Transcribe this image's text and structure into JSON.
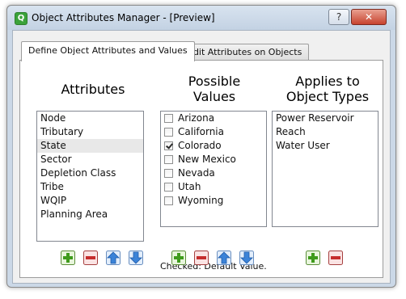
{
  "window": {
    "title": "Object Attributes Manager - [Preview]",
    "help_label": "?",
    "close_label": "✕"
  },
  "tabs": [
    {
      "label": "Define Object Attributes and Values",
      "active": true
    },
    {
      "label": "Edit Attributes on Objects",
      "active": false
    }
  ],
  "attributes": {
    "heading": "Attributes",
    "items": [
      "Node",
      "Tributary",
      "State",
      "Sector",
      "Depletion Class",
      "Tribe",
      "WQIP",
      "Planning Area"
    ],
    "selected": "State"
  },
  "values": {
    "heading_line1": "Possible",
    "heading_line2": "Values",
    "items": [
      {
        "label": "Arizona",
        "checked": false
      },
      {
        "label": "California",
        "checked": false
      },
      {
        "label": "Colorado",
        "checked": true
      },
      {
        "label": "New Mexico",
        "checked": false
      },
      {
        "label": "Nevada",
        "checked": false
      },
      {
        "label": "Utah",
        "checked": false
      },
      {
        "label": "Wyoming",
        "checked": false
      }
    ],
    "note": "Checked: Default Value."
  },
  "object_types": {
    "heading_line1": "Applies to",
    "heading_line2": "Object Types",
    "items": [
      "Power Reservoir",
      "Reach",
      "Water User"
    ]
  },
  "colors": {
    "add": "#3f9b1c",
    "remove": "#c62d2d",
    "arrow": "#3b83d8"
  },
  "icons": [
    "add-icon",
    "remove-icon",
    "up-arrow-icon",
    "down-arrow-icon"
  ]
}
